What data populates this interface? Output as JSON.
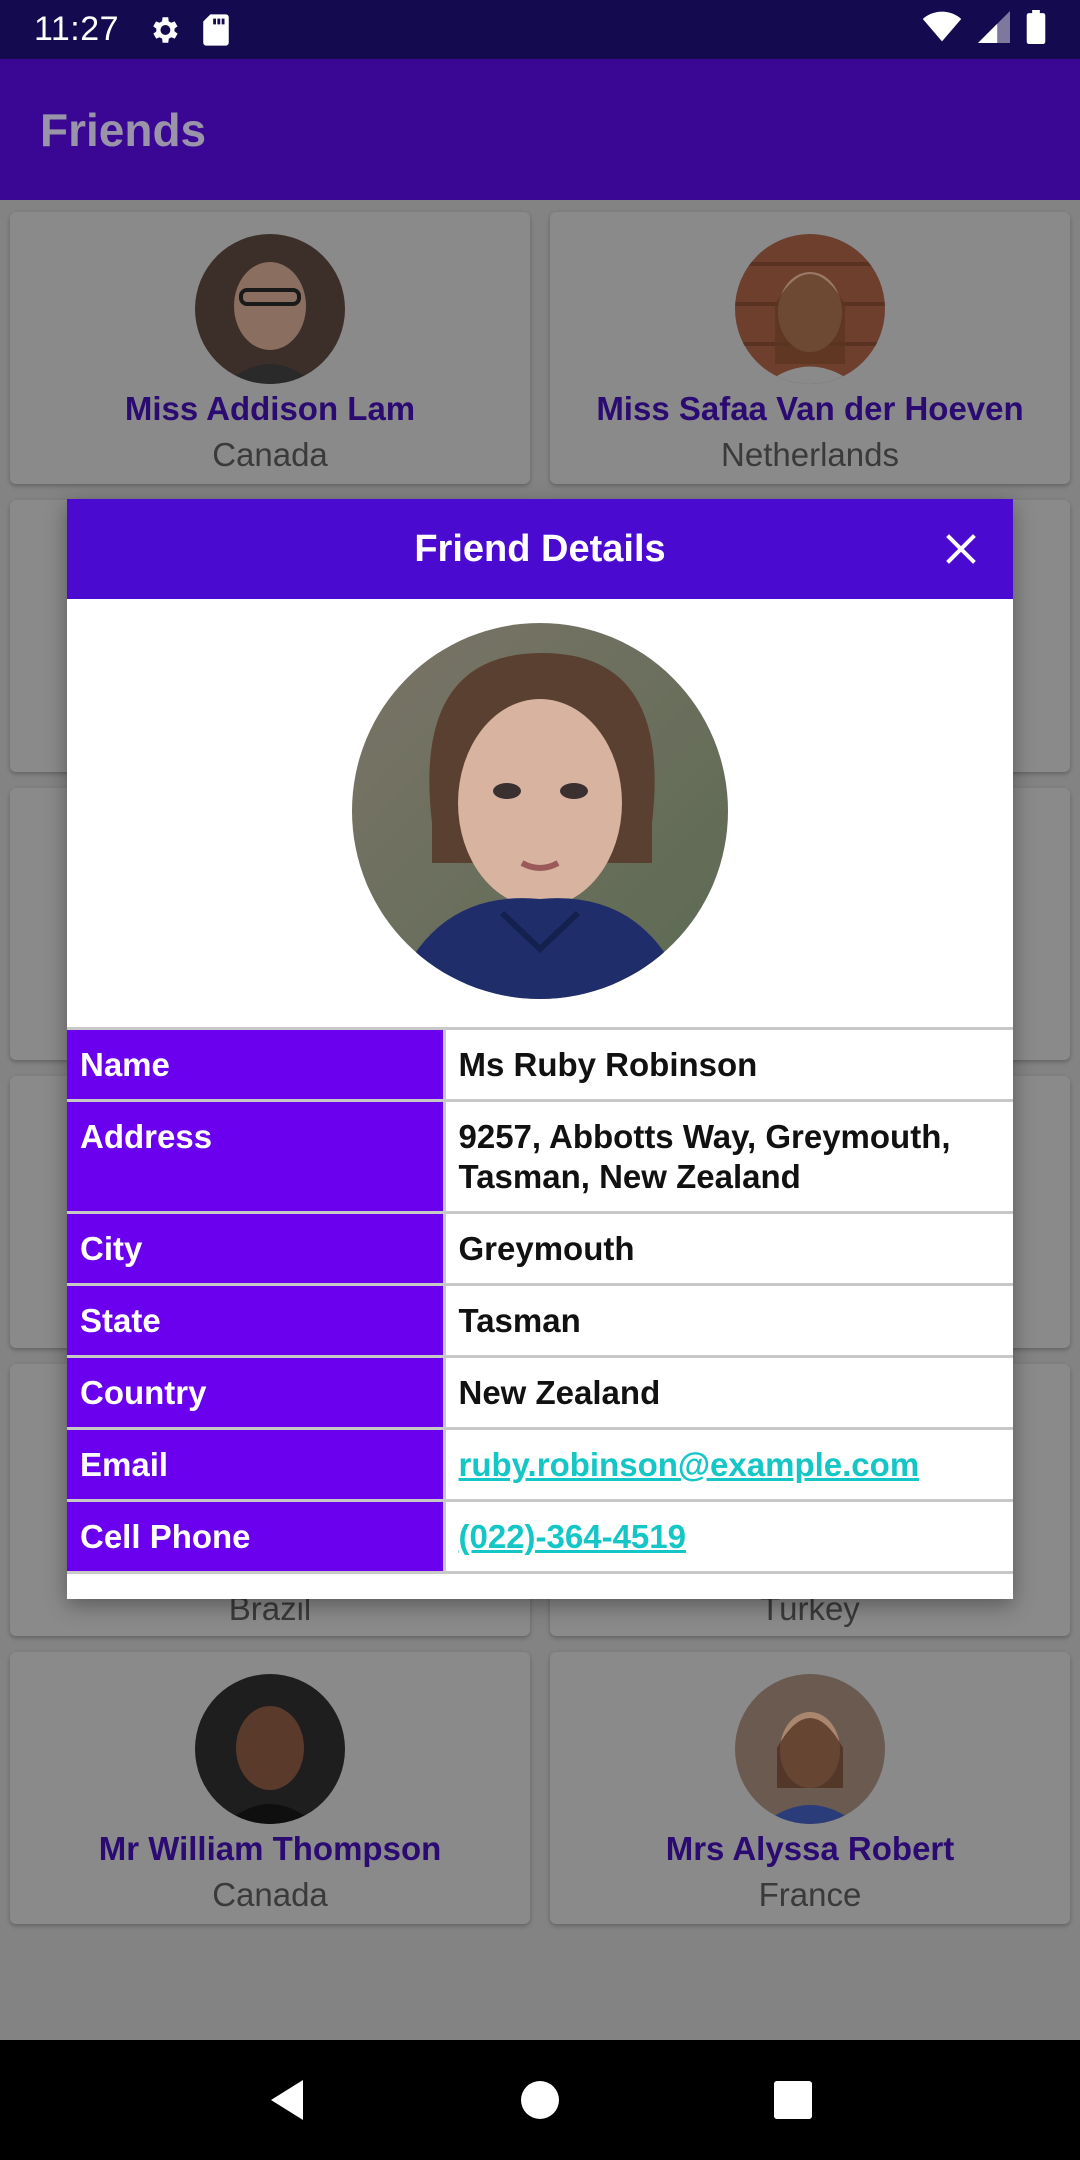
{
  "status_bar": {
    "time": "11:27"
  },
  "app_bar": {
    "title": "Friends"
  },
  "friends": [
    {
      "name": "Miss Addison Lam",
      "country": "Canada"
    },
    {
      "name": "Miss Safaa Van der Hoeven",
      "country": "Netherlands"
    },
    {
      "name": "",
      "country": "Brazil"
    },
    {
      "name": "",
      "country": "Turkey"
    },
    {
      "name": "Mr William Thompson",
      "country": "Canada"
    },
    {
      "name": "Mrs Alyssa Robert",
      "country": "France"
    }
  ],
  "dialog": {
    "title": "Friend Details",
    "rows": [
      {
        "label": "Name",
        "value": "Ms Ruby Robinson"
      },
      {
        "label": "Address",
        "value": "9257, Abbotts Way, Greymouth, Tasman, New Zealand"
      },
      {
        "label": "City",
        "value": "Greymouth"
      },
      {
        "label": "State",
        "value": "Tasman"
      },
      {
        "label": "Country",
        "value": "New Zealand"
      },
      {
        "label": "Email",
        "value": "ruby.robinson@example.com"
      },
      {
        "label": "Cell Phone",
        "value": "(022)-364-4519"
      }
    ]
  },
  "colors": {
    "status_bar": "#140a4f",
    "app_bar": "#3a0694",
    "dialog_header": "#4a0ad0",
    "label_cell": "#6a00ee",
    "link": "#14c6c6"
  },
  "icons": [
    "gear-icon",
    "sd-card-icon",
    "wifi-icon",
    "cell-signal-icon",
    "battery-icon",
    "close-icon",
    "back-icon",
    "home-icon",
    "recents-icon"
  ]
}
